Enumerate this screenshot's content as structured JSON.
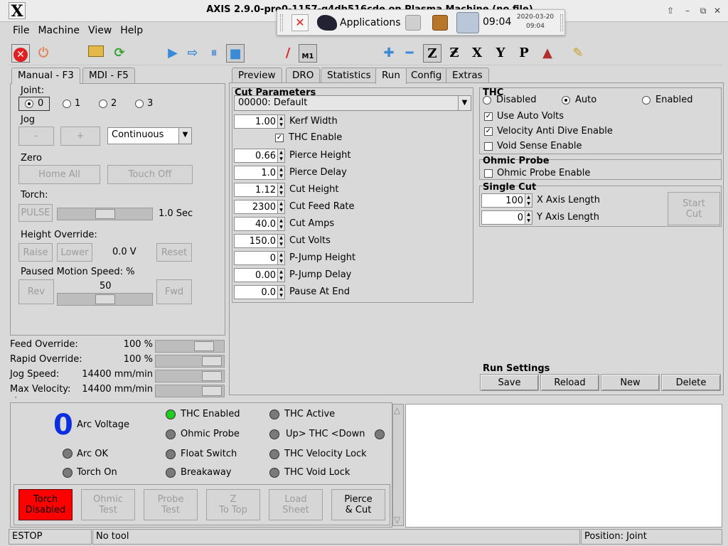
{
  "window": {
    "title": "AXIS 2.9.0-pre0-1157-g4db516cde on Plasma Machine (no file)",
    "logo": "X"
  },
  "panel": {
    "applications_label": "Applications",
    "clock": "09:04",
    "date": "2020-03-20",
    "date_time": "09:04"
  },
  "menu": [
    "File",
    "Machine",
    "View",
    "Help"
  ],
  "toolbar": {
    "icons": [
      "estop-icon",
      "power-icon",
      "open-icon",
      "reload-icon",
      "run-icon",
      "step-icon",
      "pause-icon",
      "stop-icon",
      "block-delete-icon",
      "optional-stop-icon",
      "zoom-in-icon",
      "zoom-out-icon",
      "view-z-icon",
      "view-z2-icon",
      "view-x-icon",
      "view-y-icon",
      "view-p-icon",
      "rotate-view-icon",
      "clear-plot-icon"
    ],
    "m1_label": "M1",
    "view_letters": {
      "z": "Z",
      "x": "X",
      "y": "Y",
      "p": "P"
    }
  },
  "left_tabs": [
    "Manual - F3",
    "MDI - F5"
  ],
  "manual": {
    "joint_label": "Joint:",
    "joints": [
      "0",
      "1",
      "2",
      "3"
    ],
    "selected_joint": "0",
    "jog_label": "Jog",
    "jog_minus": "-",
    "jog_plus": "+",
    "jog_mode": "Continuous",
    "zero_label": "Zero",
    "home_all": "Home All",
    "touch_off": "Touch Off",
    "torch_label": "Torch:",
    "pulse": "PULSE",
    "pulse_time": "1.0 Sec",
    "pulse_level": 0.5,
    "height_override_label": "Height Override:",
    "raise": "Raise",
    "lower": "Lower",
    "height_value": "0.0 V",
    "reset": "Reset",
    "paused_speed_label": "Paused Motion Speed: %",
    "paused_speed_value": "50",
    "paused_speed_level": 0.5,
    "rev": "Rev",
    "fwd": "Fwd"
  },
  "overrides": [
    {
      "label": "Feed Override:",
      "value": "100 %",
      "level": 0.8
    },
    {
      "label": "Rapid Override:",
      "value": "100 %",
      "level": 0.95
    },
    {
      "label": "Jog Speed:",
      "value": "14400 mm/min",
      "level": 0.95
    },
    {
      "label": "Max Velocity:",
      "value": "14400 mm/min",
      "level": 0.95
    }
  ],
  "right_tabs": [
    "Preview",
    "DRO",
    "Statistics",
    "Run",
    "Config",
    "Extras"
  ],
  "active_right_tab": "Run",
  "cut_parameters": {
    "title": "Cut Parameters",
    "material": "00000: Default",
    "thc_enable_label": "THC Enable",
    "thc_enable_checked": true,
    "fields": [
      {
        "value": "1.00",
        "label": "Kerf Width"
      },
      {
        "value": "0.66",
        "label": "Pierce Height"
      },
      {
        "value": "1.0",
        "label": "Pierce Delay"
      },
      {
        "value": "1.12",
        "label": "Cut Height"
      },
      {
        "value": "2300",
        "label": "Cut Feed Rate"
      },
      {
        "value": "40.0",
        "label": "Cut Amps"
      },
      {
        "value": "150.0",
        "label": "Cut Volts"
      },
      {
        "value": "0",
        "label": "P-Jump Height"
      },
      {
        "value": "0.00",
        "label": "P-Jump Delay"
      },
      {
        "value": "0.0",
        "label": "Pause At End"
      }
    ]
  },
  "thc": {
    "title": "THC",
    "modes": [
      "Disabled",
      "Auto",
      "Enabled"
    ],
    "selected_mode": "Auto",
    "use_auto_volts": "Use Auto Volts",
    "velocity_anti_dive": "Velocity Anti Dive Enable",
    "void_sense": "Void Sense Enable"
  },
  "ohmic": {
    "title": "Ohmic Probe",
    "enable_label": "Ohmic Probe Enable"
  },
  "single_cut": {
    "title": "Single Cut",
    "x_value": "100",
    "x_label": "X Axis Length",
    "y_value": "0",
    "y_label": "Y Axis Length",
    "start_button": "Start\nCut"
  },
  "run_settings": {
    "title": "Run Settings",
    "buttons": [
      "Save",
      "Reload",
      "New",
      "Delete"
    ]
  },
  "status_panel": {
    "arc_voltage_value": "0",
    "arc_voltage_label": "Arc Voltage",
    "arc_ok": "Arc OK",
    "torch_on": "Torch On",
    "thc_enabled": "THC Enabled",
    "ohmic_probe": "Ohmic Probe",
    "float_switch": "Float Switch",
    "breakaway": "Breakaway",
    "thc_active": "THC Active",
    "up_thc_down": "Up> THC <Down",
    "thc_velocity_lock": "THC Velocity Lock",
    "thc_void_lock": "THC Void Lock",
    "led_on_color": "#22cc22",
    "torch_button_color": "#ff0000"
  },
  "bottom_buttons": {
    "torch": "Torch\nDisabled",
    "ohmic_test": "Ohmic\nTest",
    "probe_test": "Probe\nTest",
    "z_to_top": "Z\nTo Top",
    "load_sheet": "Load\nSheet",
    "pierce_cut": "Pierce\n& Cut"
  },
  "statusbar": {
    "state": "ESTOP",
    "tool": "No tool",
    "position": "Position: Joint"
  }
}
